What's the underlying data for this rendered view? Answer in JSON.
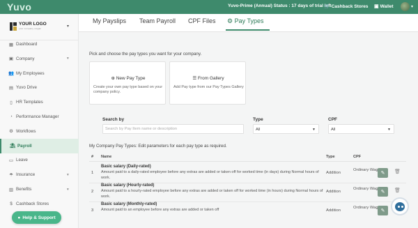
{
  "topbar": {
    "brand": "Yuvo",
    "trial_status": "Yuvo-Prime (Annual) Status : 17 days of trial left",
    "cashback_label": "Cashback Stores",
    "cashback_icon": "cart-icon",
    "wallet_label": "Wallet",
    "wallet_icon": "wallet-icon",
    "accent_color": "#3e8a6c"
  },
  "sidebar": {
    "logo_text": "YOUR LOGO",
    "logo_tagline": "your company slogan",
    "items": [
      {
        "label": "Dashboard",
        "icon": "grid-icon",
        "glyph": "▦",
        "has_caret": false
      },
      {
        "label": "Company",
        "icon": "building-icon",
        "glyph": "▣",
        "has_caret": true
      },
      {
        "label": "My Employees",
        "icon": "users-icon",
        "glyph": "👥",
        "has_caret": false
      },
      {
        "label": "Yuvo Drive",
        "icon": "drive-icon",
        "glyph": "▤",
        "has_caret": false
      },
      {
        "label": "HR Templates",
        "icon": "document-icon",
        "glyph": "▯",
        "has_caret": false
      },
      {
        "label": "Performance Manager",
        "icon": "gauge-icon",
        "glyph": "◔",
        "has_caret": false
      },
      {
        "label": "Workflows",
        "icon": "cogs-icon",
        "glyph": "⚙",
        "has_caret": false
      },
      {
        "label": "Payroll",
        "icon": "payroll-icon",
        "glyph": "⛱",
        "has_caret": false
      },
      {
        "label": "Leave",
        "icon": "leave-icon",
        "glyph": "▭",
        "has_caret": false
      },
      {
        "label": "Insurance",
        "icon": "umbrella-icon",
        "glyph": "☂",
        "has_caret": true
      },
      {
        "label": "Benefits",
        "icon": "gift-icon",
        "glyph": "▥",
        "has_caret": true
      },
      {
        "label": "Cashback Stores",
        "icon": "dollar-icon",
        "glyph": "$",
        "has_caret": false
      }
    ],
    "active_item": "Payroll",
    "help_label": "Help & Support"
  },
  "tabs": {
    "items": [
      "My Payslips",
      "Team Payroll",
      "CPF Files",
      "Pay Types"
    ],
    "active": "Pay Types"
  },
  "main": {
    "intro": "Pick and choose the pay types you want for your company.",
    "cards": [
      {
        "title": "New Pay Type",
        "icon": "plus-circle-icon",
        "description": "Create your own pay type based on your company policy."
      },
      {
        "title": "From Gallery",
        "icon": "list-icon",
        "description": "Add Pay type from our Pay Types Gallery"
      }
    ],
    "filters": {
      "search_label": "Search by",
      "search_placeholder": "Search by Pay Item name or description",
      "search_value": "",
      "type_label": "Type",
      "type_value": "All",
      "cpf_label": "CPF",
      "cpf_value": "All"
    },
    "list_title": "My Company Pay Types: Edit parameters for each pay type as required.",
    "columns": [
      "#",
      "Name",
      "Type",
      "CPF"
    ],
    "rows": [
      {
        "num": "1",
        "name": "Basic salary (Daily-rated)",
        "description": "Amount paid to a daily-rated employee before any extras are added or taken off for worked time (in days) during Normal hours of work.",
        "type": "Addition",
        "cpf": "Ordinary Wage"
      },
      {
        "num": "2",
        "name": "Basic salary (Hourly-rated)",
        "description": "Amount paid to a hourly-rated employee before any extras are added or taken off for worked time (in hours) during Normal hours of work.",
        "type": "Addition",
        "cpf": "Ordinary Wage"
      },
      {
        "num": "3",
        "name": "Basic salary (Monthly-rated)",
        "description": "Amount paid to an employee before any extras are added or taken off",
        "type": "Addition",
        "cpf": "Ordinary Wage"
      }
    ]
  }
}
